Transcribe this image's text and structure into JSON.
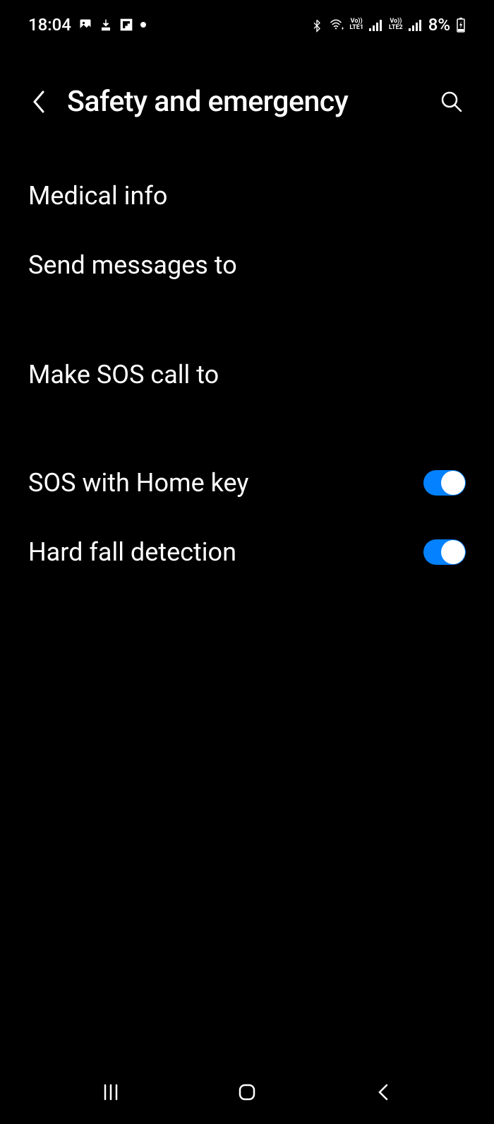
{
  "statusBar": {
    "time": "18:04",
    "batteryPercent": "8%",
    "lte1": "LTE1",
    "lte2": "LTE2",
    "vo1": "Vo))",
    "vo2": "Vo))"
  },
  "header": {
    "title": "Safety and emergency"
  },
  "settings": {
    "medicalInfo": "Medical info",
    "sendMessages": "Send messages to",
    "makeSosCall": "Make SOS call to",
    "sosHomeKey": {
      "label": "SOS with Home key",
      "enabled": true
    },
    "hardFallDetection": {
      "label": "Hard fall detection",
      "enabled": true
    }
  }
}
